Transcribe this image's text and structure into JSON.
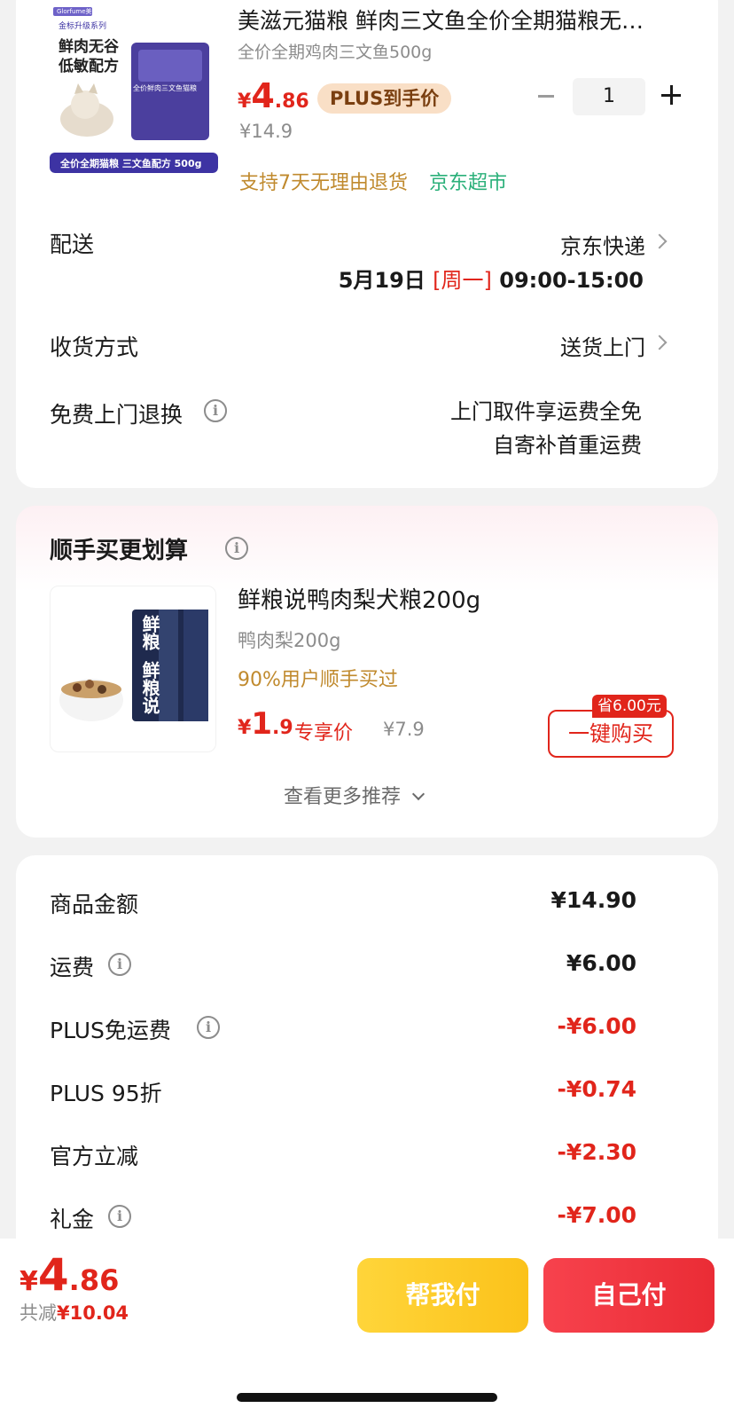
{
  "product": {
    "title": "美滋元猫粮 鲜肉三文鱼全价全期猫粮无…",
    "spec": "全价全期鸡肉三文鱼500g",
    "currency": "¥",
    "price_int": "4",
    "price_dec": ".86",
    "plus_badge": "PLUS到手价",
    "orig_price": "¥14.9",
    "quantity": "1",
    "return_policy": "支持7天无理由退货",
    "store": "京东超市",
    "image_texts": {
      "brand": "Glorfume美滋元",
      "series": "金标升级系列",
      "headline_1": "鲜肉无谷",
      "headline_2": "低敏配方",
      "bag_label": "全价鲜肉三文鱼猫粮",
      "bottom_banner": "全价全期猫粮 三文鱼配方 500g"
    }
  },
  "delivery": {
    "label": "配送",
    "carrier": "京东快递",
    "date": "5月19日",
    "weekday": "[周一]",
    "time": "09:00-15:00"
  },
  "receive": {
    "label": "收货方式",
    "value": "送货上门"
  },
  "free_return": {
    "label": "免费上门退换",
    "line1": "上门取件享运费全免",
    "line2": "自寄补首重运费"
  },
  "recommend": {
    "title": "顺手买更划算",
    "item_title": "鲜粮说鸭肉梨犬粮200g",
    "item_spec": "鸭肉梨200g",
    "item_note": "90%用户顺手买过",
    "price_int": "1",
    "price_dec": ".9",
    "price_tag": "专享价",
    "orig_price": "¥7.9",
    "save_tag": "省6.00元",
    "buy_label": "一键购买",
    "more_label": "查看更多推荐",
    "image_texts": {
      "vertical_1": "鲜粮",
      "vertical_2": "鲜粮说"
    }
  },
  "summary": {
    "rows": [
      {
        "label": "商品金额",
        "value": "¥14.90"
      },
      {
        "label": "运费",
        "value": "¥6.00"
      },
      {
        "label": "PLUS免运费",
        "value": "-¥6.00"
      },
      {
        "label": "PLUS 95折",
        "value": "-¥0.74"
      },
      {
        "label": "官方立减",
        "value": "-¥2.30"
      },
      {
        "label": "礼金",
        "value": "-¥7.00"
      }
    ]
  },
  "bottom": {
    "currency": "¥",
    "total_int": "4",
    "total_dec": ".86",
    "saved_label": "共减",
    "saved_value": "¥10.04",
    "help_pay": "帮我付",
    "self_pay": "自己付"
  },
  "colors": {
    "accent_red": "#e1251b",
    "green": "#2bb07a",
    "gold_text": "#c08a2e",
    "plus_badge_bg": "#f9dfc6"
  }
}
